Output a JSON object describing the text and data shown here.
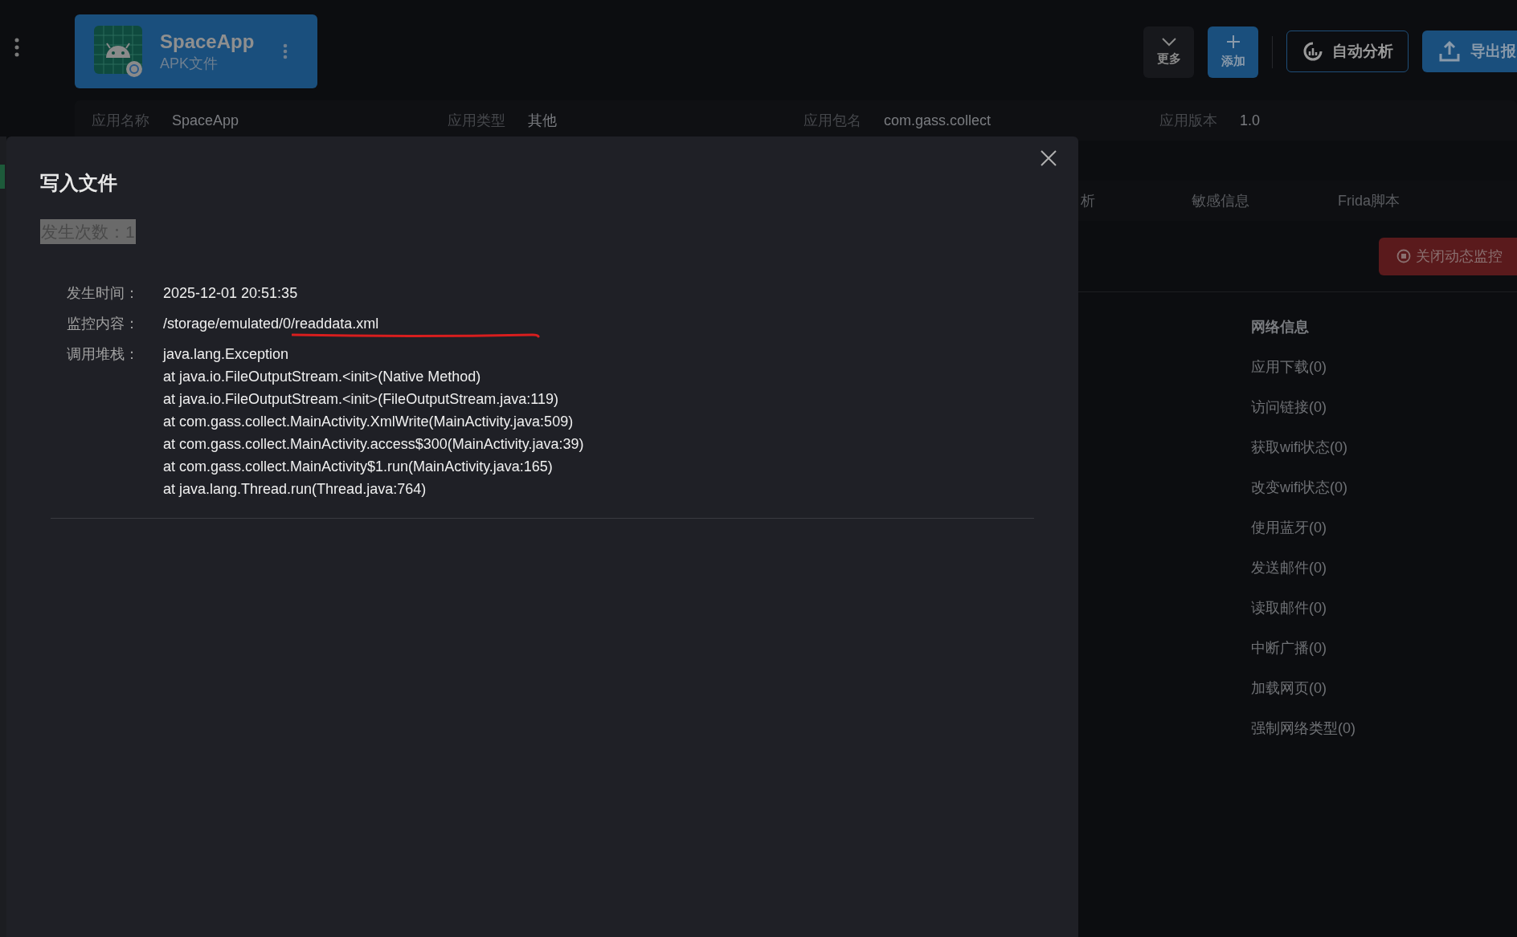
{
  "app_card": {
    "name": "SpaceApp",
    "type": "APK文件"
  },
  "toolbar": [
    {
      "kind": "more",
      "label": "更多"
    },
    {
      "kind": "add",
      "label": "添加"
    },
    {
      "kind": "analyze",
      "label": "自动分析"
    },
    {
      "kind": "export",
      "label": "导出报"
    }
  ],
  "info": [
    {
      "label": "应用名称",
      "value": "SpaceApp"
    },
    {
      "label": "应用类型",
      "value": "其他"
    },
    {
      "label": "应用包名",
      "value": "com.gass.collect"
    },
    {
      "label": "应用版本",
      "value": "1.0"
    }
  ],
  "tabs": [
    "析",
    "敏感信息",
    "Frida脚本"
  ],
  "monitor_button": "关闭动态监控",
  "network": {
    "title": "网络信息",
    "items": [
      "应用下载(0)",
      "访问链接(0)",
      "获取wifi状态(0)",
      "改变wifi状态(0)",
      "使用蓝牙(0)",
      "发送邮件(0)",
      "读取邮件(0)",
      "中断广播(0)",
      "加载网页(0)",
      "强制网络类型(0)"
    ]
  },
  "dialog": {
    "title": "写入文件",
    "count_badge": "发生次数：1",
    "details": [
      {
        "label": "发生时间：",
        "underlined": false,
        "lines": [
          "2025-12-01 20:51:35"
        ]
      },
      {
        "label": "监控内容：",
        "underlined": true,
        "lines": [
          "/storage/emulated/0/readdata.xml"
        ]
      },
      {
        "label": "调用堆栈：",
        "underlined": false,
        "lines": [
          "java.lang.Exception",
          "at java.io.FileOutputStream.<init>(Native Method)",
          "at java.io.FileOutputStream.<init>(FileOutputStream.java:119)",
          "at com.gass.collect.MainActivity.XmlWrite(MainActivity.java:509)",
          "at com.gass.collect.MainActivity.access$300(MainActivity.java:39)",
          "at com.gass.collect.MainActivity$1.run(MainActivity.java:165)",
          "at java.lang.Thread.run(Thread.java:764)"
        ]
      }
    ]
  }
}
